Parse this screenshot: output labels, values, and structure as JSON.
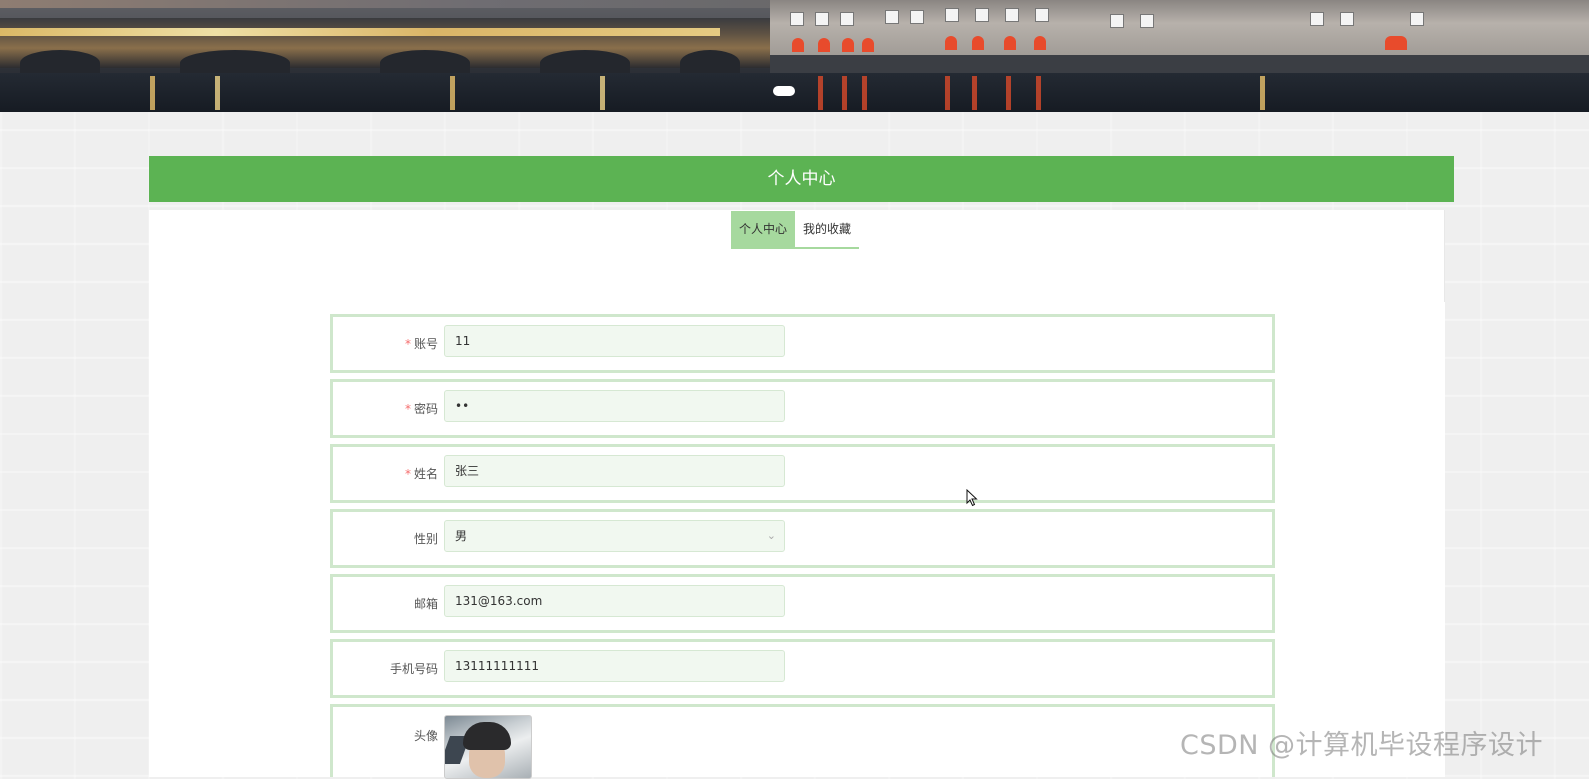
{
  "page": {
    "header_title": "个人中心"
  },
  "tabs": [
    {
      "label": "个人中心",
      "active": true
    },
    {
      "label": "我的收藏",
      "active": false
    }
  ],
  "form": {
    "account": {
      "label": "账号",
      "required": true,
      "value": "11"
    },
    "password": {
      "label": "密码",
      "required": true,
      "value": "••"
    },
    "name": {
      "label": "姓名",
      "required": true,
      "value": "张三"
    },
    "gender": {
      "label": "性别",
      "required": false,
      "value": "男"
    },
    "email": {
      "label": "邮箱",
      "required": false,
      "value": "131@163.com"
    },
    "phone": {
      "label": "手机号码",
      "required": false,
      "value": "13111111111"
    },
    "avatar": {
      "label": "头像",
      "required": false
    }
  },
  "watermark": "CSDN @计算机毕设程序设计",
  "colors": {
    "accent": "#5cb353",
    "tab_active": "#a6d99e",
    "row_border": "#cfe7cc",
    "input_bg": "#f1f8f0",
    "required": "#f56c6c"
  },
  "icons": {
    "select_arrow": "chevron-down-icon",
    "cursor": "mouse-pointer-icon"
  }
}
